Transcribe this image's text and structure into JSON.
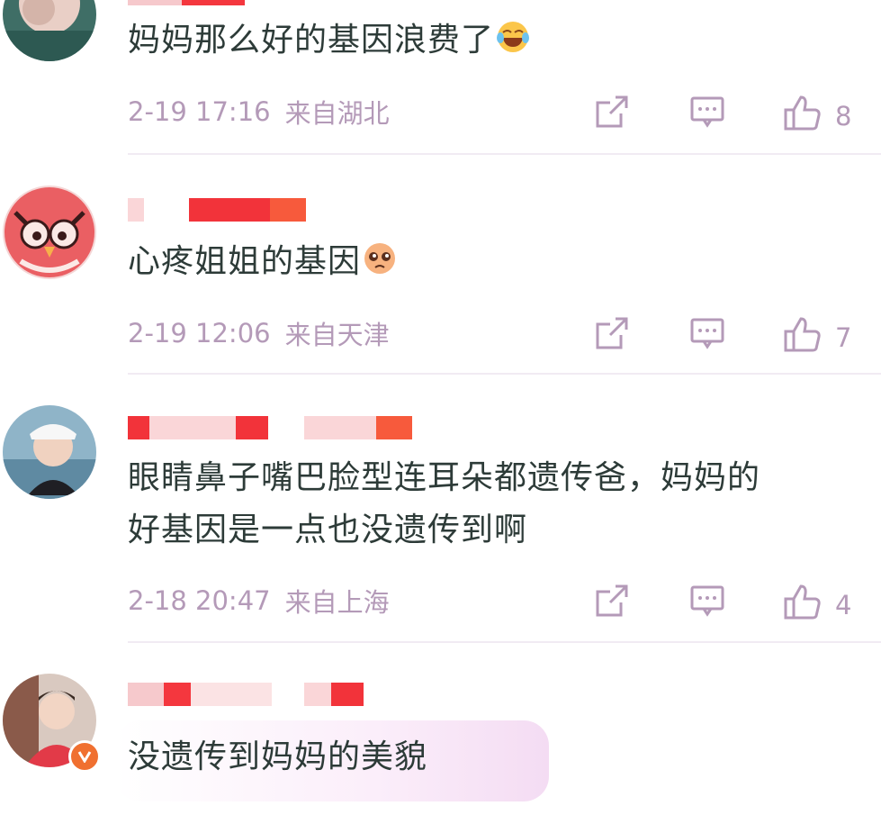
{
  "comments": [
    {
      "text": "妈妈那么好的基因浪费了",
      "emoji": "laughing-crying-emoji",
      "time": "2-19 17:16",
      "location": "来自湖北",
      "likes": "8"
    },
    {
      "text": "心疼姐姐的基因",
      "emoji": "pleading-face-emoji",
      "time": "2-19 12:06",
      "location": "来自天津",
      "likes": "7"
    },
    {
      "text_line1": "眼睛鼻子嘴巴脸型连耳朵都遗传爸，妈妈的",
      "text_line2": "好基因是一点也没遗传到啊",
      "time": "2-18 20:47",
      "location": "来自上海",
      "likes": "4"
    },
    {
      "text": "没遗传到妈妈的美貌",
      "badge": "verified-v-badge"
    }
  ],
  "colors": {
    "meta": "#b49ab8",
    "text": "#2d3b38",
    "censor": "#f2333a",
    "badge": "#f07030"
  },
  "icons": {
    "share": "share-icon",
    "reply": "comment-icon",
    "like": "thumbs-up-icon"
  }
}
